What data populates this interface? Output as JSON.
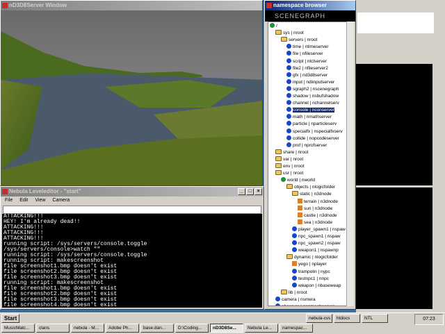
{
  "scene_window": {
    "title": "nD3D8Server Window"
  },
  "editor": {
    "title": "Nebula Leveleditor - \"start\"",
    "menu": [
      "File",
      "Edit",
      "View",
      "Camera"
    ],
    "console_lines": [
      "ATTACKING!!!",
      "HEY! I'm already dead!!",
      "ATTACKING!!!",
      "ATTACKING!!!",
      "ATTACKING!!!",
      "running script: /sys/servers/console.toggle",
      "/sys/servers/console>watch \"\"",
      "running script: /sys/servers/console.toggle",
      "running script: makescreenshot",
      "file screenshot1.bmp doesn't exist",
      "file screenshot2.bmp doesn't exist",
      "file screenshot3.bmp doesn't exist",
      "running script: makescreenshot",
      "file screenshot1.bmp doesn't exist",
      "file screenshot2.bmp doesn't exist",
      "file screenshot3.bmp doesn't exist",
      "file screenshot4.bmp doesn't exist"
    ]
  },
  "nsbrowser": {
    "title": "namespace browser",
    "header": "SCENEGRAPH",
    "tree": [
      {
        "label": "/",
        "icon": "globe-icon"
      },
      {
        "label": "sys | nroot",
        "icon": "folder-icon"
      },
      {
        "label": "servers | nroot",
        "icon": "folder-icon"
      },
      {
        "label": "time | ntimeserver",
        "icon": "node-icon"
      },
      {
        "label": "file | nfileserver",
        "icon": "node-icon"
      },
      {
        "label": "script | ntclserver",
        "icon": "node-icon"
      },
      {
        "label": "file2 | nfileserver2",
        "icon": "node-icon"
      },
      {
        "label": "gfx | nd3d8server",
        "icon": "node-icon"
      },
      {
        "label": "input | ndiinputserver",
        "icon": "node-icon"
      },
      {
        "label": "sgraph2 | nscenegraph",
        "icon": "node-icon"
      },
      {
        "label": "shadow | nsbufshadow",
        "icon": "node-icon"
      },
      {
        "label": "channel | nchannelserv",
        "icon": "node-icon"
      },
      {
        "label": "console | nconserver",
        "icon": "node-icon",
        "selected": true
      },
      {
        "label": "math | nmathserver",
        "icon": "node-icon"
      },
      {
        "label": "particle | nparticleserv",
        "icon": "node-icon"
      },
      {
        "label": "specialfx | nspecialfxserv",
        "icon": "node-icon"
      },
      {
        "label": "collide | nopcodeserver",
        "icon": "node-icon"
      },
      {
        "label": "prof | nprofserver",
        "icon": "node-icon"
      },
      {
        "label": "share | nroot",
        "icon": "folder-icon"
      },
      {
        "label": "var | nroot",
        "icon": "folder-icon"
      },
      {
        "label": "env | nroot",
        "icon": "folder-icon"
      },
      {
        "label": "usr | nroot",
        "icon": "folder-icon"
      },
      {
        "label": "world | nworld",
        "icon": "globe-icon"
      },
      {
        "label": "objects | nlogicfolder",
        "icon": "folder-icon"
      },
      {
        "label": "static | n3dnode",
        "icon": "folder-icon"
      },
      {
        "label": "terrain | n3dnode",
        "icon": "cube-icon"
      },
      {
        "label": "sun | n3dnode",
        "icon": "cube-icon"
      },
      {
        "label": "castle | n3dnode",
        "icon": "cube-icon"
      },
      {
        "label": "sea | n3dnode",
        "icon": "cube-icon"
      },
      {
        "label": "player_spawn1 | nspaw",
        "icon": "node-icon"
      },
      {
        "label": "npc_spawn1 | nspaw",
        "icon": "node-icon"
      },
      {
        "label": "npc_spawn2 | nspaw",
        "icon": "node-icon"
      },
      {
        "label": "weapon1 | nspawnp",
        "icon": "node-icon"
      },
      {
        "label": "dynamic | nlogicfolder",
        "icon": "folder-icon"
      },
      {
        "label": "yego | nplayer",
        "icon": "cube-icon"
      },
      {
        "label": "trampolin | nypc",
        "icon": "node-icon"
      },
      {
        "label": "testnpc1 | nnpc",
        "icon": "node-icon"
      },
      {
        "label": "weapon | nbaseweap",
        "icon": "node-icon"
      },
      {
        "label": "lib | nroot",
        "icon": "folder-icon"
      },
      {
        "label": "camera | nsmera",
        "icon": "node-icon"
      },
      {
        "label": "observer | ngameobserver",
        "icon": "node-icon"
      }
    ]
  },
  "taskbar": {
    "start": "Start",
    "row1": [
      "MusicMatc...",
      "clans",
      "nebula - M...",
      "Adobe Ph...",
      "base.dan...",
      "D:\\Coding...",
      "nD3D8Se...",
      "Nebula Le...",
      "namespac..."
    ],
    "row2": [
      "nebula-cvs",
      "htdocs",
      "NTL"
    ],
    "clock": "07:23"
  },
  "colors": {
    "accent": "#0a246a",
    "desktop": "#3a6ea5",
    "window": "#d4d0c8"
  }
}
